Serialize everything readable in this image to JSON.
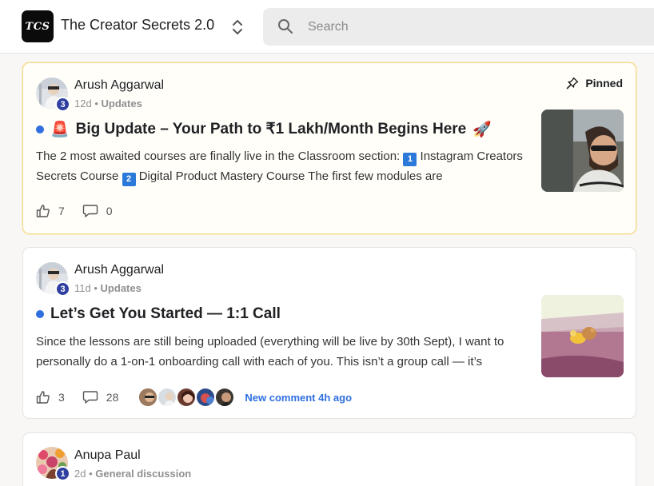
{
  "header": {
    "logo_text": "TCS",
    "community_name": "The Creator Secrets 2.0",
    "switcher_icon": "chevron-up-down-icon",
    "search": {
      "placeholder": "Search",
      "icon": "search-icon"
    }
  },
  "posts": [
    {
      "author": "Arush Aggarwal",
      "level": "3",
      "time": "12d",
      "separator": "•",
      "category": "Updates",
      "pinned_label": "Pinned",
      "title_prefix": "🚨",
      "title": "Big Update – Your Path to ₹1 Lakh/Month Begins Here",
      "title_suffix": "🚀",
      "excerpt_1": "The 2 most awaited courses are finally live in the Classroom section: ",
      "excerpt_badge_1": "1",
      "excerpt_2": " Instagram Creators Secrets Course ",
      "excerpt_badge_2": "2",
      "excerpt_3": " Digital Product Mastery Course The first few modules are",
      "likes": "7",
      "comments": "0",
      "unread_color": "#2f6fe0"
    },
    {
      "author": "Arush Aggarwal",
      "level": "3",
      "time": "11d",
      "separator": "•",
      "category": "Updates",
      "title": "Let’s Get You Started — 1:1 Call",
      "excerpt": "Since the lessons are still being uploaded (everything will be live by 30th Sept), I want to personally do a 1-on-1 onboarding call with each of you. This isn’t a group call — it’s",
      "likes": "3",
      "comments": "28",
      "new_comment": "New comment 4h ago",
      "unread_color": "#2f6fe0"
    },
    {
      "author": "Anupa Paul",
      "level": "1",
      "time": "2d",
      "separator": "•",
      "category": "General discussion"
    }
  ]
}
